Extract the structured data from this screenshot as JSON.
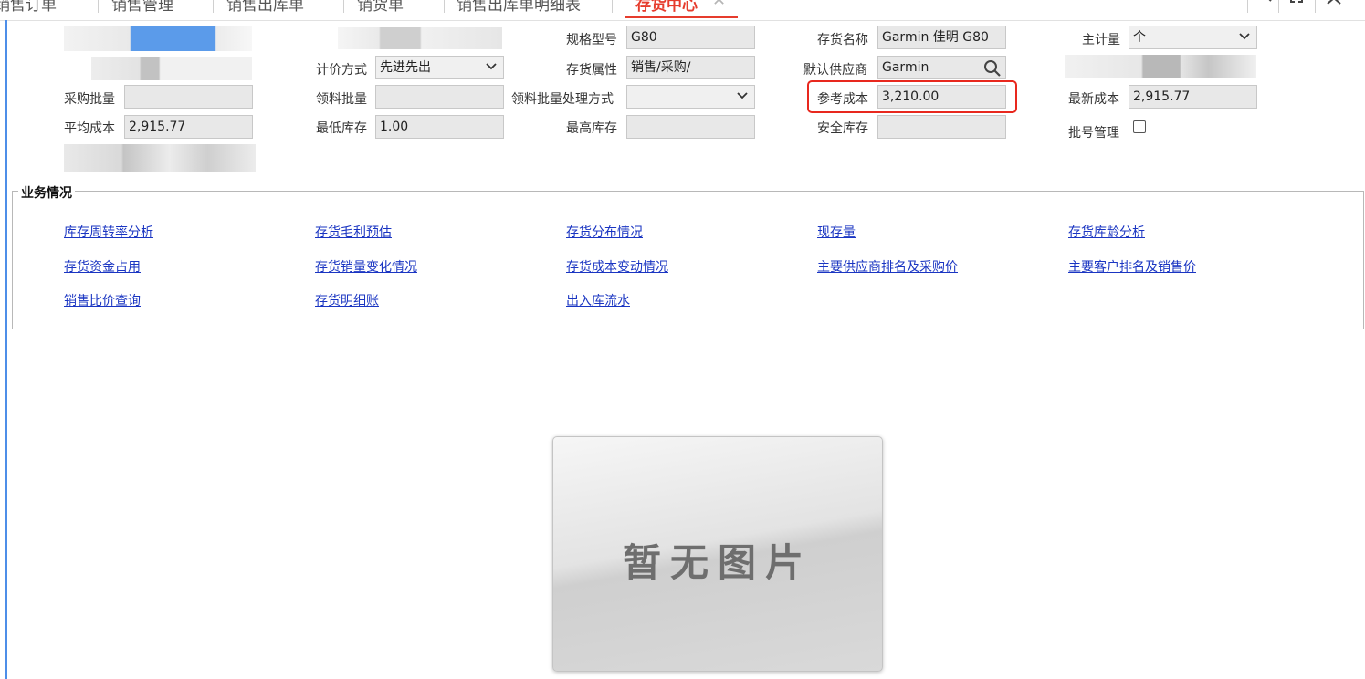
{
  "tabs": [
    {
      "label": "销售订单"
    },
    {
      "label": "销售管理"
    },
    {
      "label": "销售出库单"
    },
    {
      "label": "销货单"
    },
    {
      "label": "销售出库单明细表"
    },
    {
      "label": "存货中心",
      "active": true
    }
  ],
  "tab_close": "✕",
  "window_icons": {
    "search": "search-icon",
    "maximize": "maximize-icon",
    "close": "close-icon"
  },
  "form": {
    "spec_model": {
      "label": "规格型号",
      "value": "G80"
    },
    "item_name": {
      "label": "存货名称",
      "value": "Garmin 佳明 G80"
    },
    "main_unit": {
      "label": "主计量",
      "value": "个"
    },
    "valuation_method": {
      "label": "计价方式",
      "value": "先进先出"
    },
    "item_attribute": {
      "label": "存货属性",
      "value": "销售/采购/"
    },
    "default_supplier": {
      "label": "默认供应商",
      "value": "Garmin"
    },
    "purchase_batch": {
      "label": "采购批量",
      "value": ""
    },
    "pick_batch": {
      "label": "领料批量",
      "value": ""
    },
    "pick_batch_method": {
      "label": "领料批量处理方式",
      "value": ""
    },
    "reference_cost": {
      "label": "参考成本",
      "value": "3,210.00"
    },
    "latest_cost": {
      "label": "最新成本",
      "value": "2,915.77"
    },
    "average_cost": {
      "label": "平均成本",
      "value": "2,915.77"
    },
    "min_stock": {
      "label": "最低库存",
      "value": "1.00"
    },
    "max_stock": {
      "label": "最高库存",
      "value": ""
    },
    "safety_stock": {
      "label": "安全库存",
      "value": ""
    },
    "batch_management": {
      "label": "批号管理",
      "checked": false
    }
  },
  "business": {
    "title": "业务情况",
    "links": [
      "库存周转率分析",
      "存货毛利预估",
      "存货分布情况",
      "现存量",
      "存货库龄分析",
      "存货资金占用",
      "存货销量变化情况",
      "存货成本变动情况",
      "主要供应商排名及采购价",
      "主要客户排名及销售价",
      "销售比价查询",
      "存货明细账",
      "出入库流水"
    ]
  },
  "image_placeholder": {
    "text": "暂无图片"
  },
  "colors": {
    "accent": "#e63c2d",
    "link": "#1a35c2",
    "highlight": "#e8281e",
    "field_bg": "#e8e8e8"
  }
}
